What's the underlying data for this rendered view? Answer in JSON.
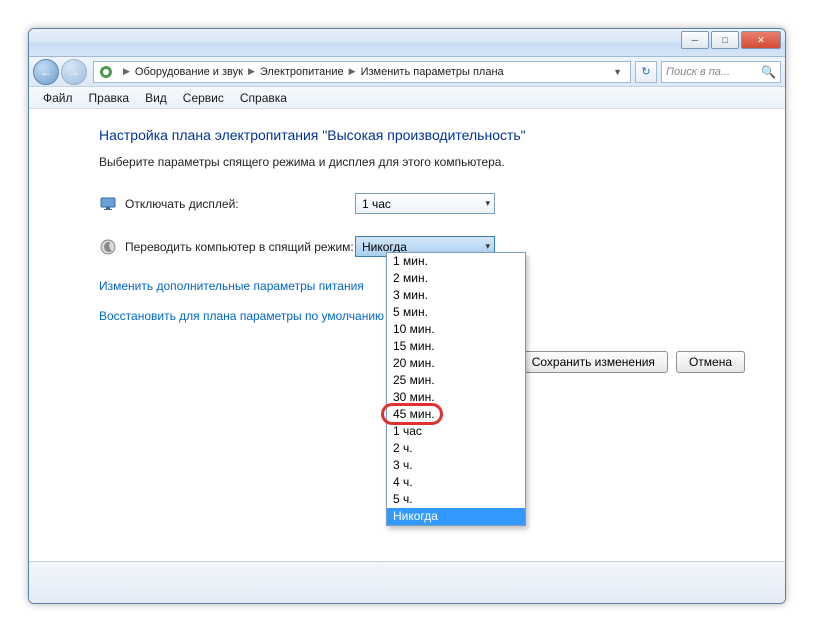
{
  "titlebar": {
    "minimize": "─",
    "maximize": "□",
    "close": "✕"
  },
  "addressbar": {
    "back": "←",
    "forward": "→",
    "crumbs": [
      "Оборудование и звук",
      "Электропитание",
      "Изменить параметры плана"
    ],
    "sep": "▶",
    "dropdown": "▼",
    "refresh": "↻",
    "search_placeholder": "Поиск в па...",
    "search_icon": "🔍"
  },
  "menu": {
    "items": [
      "Файл",
      "Правка",
      "Вид",
      "Сервис",
      "Справка"
    ]
  },
  "content": {
    "title": "Настройка плана электропитания \"Высокая производительность\"",
    "subtitle": "Выберите параметры спящего режима и дисплея для этого компьютера.",
    "settings": [
      {
        "icon": "display",
        "label": "Отключать дисплей:",
        "value": "1 час"
      },
      {
        "icon": "sleep",
        "label": "Переводить компьютер в спящий режим:",
        "value": "Никогда"
      }
    ],
    "combo_arrow": "▾",
    "links": [
      "Изменить дополнительные параметры питания",
      "Восстановить для плана параметры по умолчанию"
    ],
    "buttons": {
      "save": "Сохранить изменения",
      "cancel": "Отмена"
    }
  },
  "dropdown": {
    "options": [
      "1 мин.",
      "2 мин.",
      "3 мин.",
      "5 мин.",
      "10 мин.",
      "15 мин.",
      "20 мин.",
      "25 мин.",
      "30 мин.",
      "45 мин.",
      "1 час",
      "2 ч.",
      "3 ч.",
      "4 ч.",
      "5 ч.",
      "Никогда"
    ],
    "selected_index": 15,
    "highlighted_index": 10
  }
}
